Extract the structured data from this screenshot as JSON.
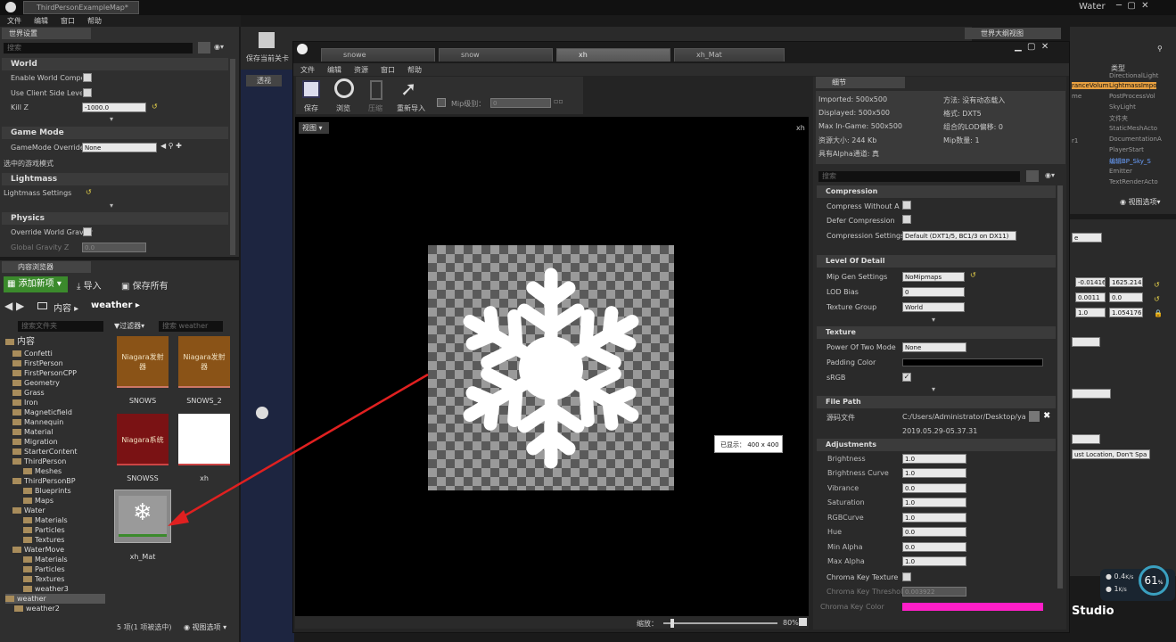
{
  "app": {
    "tab_title": "ThirdPersonExampleMap*",
    "project": "Water",
    "menu": [
      "文件",
      "编辑",
      "窗口",
      "帮助"
    ]
  },
  "world_settings": {
    "title": "世界设置",
    "search_placeholder": "搜索",
    "world": {
      "header": "World",
      "enable_world_composition": "Enable World Compositi",
      "use_client_side_level": "Use Client Side Level S",
      "kill_z_label": "Kill Z",
      "kill_z_value": "-1000.0"
    },
    "game_mode": {
      "header": "Game Mode",
      "override_label": "GameMode Override",
      "override_value": "None",
      "selected_mode": "选中的游戏模式"
    },
    "lightmass": {
      "header": "Lightmass",
      "settings": "Lightmass Settings"
    },
    "physics": {
      "header": "Physics",
      "override_gravity": "Override World Gravity",
      "global_gravity": "Global Gravity Z",
      "global_gravity_value": "0.0"
    }
  },
  "content_browser": {
    "title": "内容浏览器",
    "add_new": "添加新项",
    "import": "导入",
    "save_all": "保存所有",
    "path": [
      "内容",
      "weather"
    ],
    "search_folders": "搜索文件夹",
    "filters": "过滤器",
    "search_assets": "搜索 weather",
    "folders": [
      "内容",
      "Confetti",
      "FirstPerson",
      "FirstPersonCPP",
      "Geometry",
      "Grass",
      "Iron",
      "Magneticfield",
      "Mannequin",
      "Material",
      "Migration",
      "StarterContent",
      "ThirdPerson",
      "Meshes",
      "ThirdPersonBP",
      "Blueprints",
      "Maps",
      "Water",
      "Materials",
      "Particles",
      "Textures",
      "WaterMove",
      "Materials",
      "Particles",
      "Textures",
      "weather3",
      "weather",
      "weather2"
    ],
    "assets": [
      {
        "name": "SNOWS",
        "thumb": "Niagara发射器"
      },
      {
        "name": "SNOWS_2",
        "thumb": "Niagara发射器"
      },
      {
        "name": "SNOWSS",
        "thumb": "Niagara系统"
      },
      {
        "name": "xh",
        "thumb": ""
      },
      {
        "name": "xh_Mat",
        "thumb": ""
      }
    ],
    "status": "5 项(1 项被选中)",
    "view_options": "视图选项"
  },
  "main_toolbar": {
    "save_level": "保存当前关卡"
  },
  "viewport_label": "透视",
  "texture_editor": {
    "tabs": [
      "snowe",
      "snow",
      "xh",
      "xh_Mat"
    ],
    "menu": [
      "文件",
      "编辑",
      "资源",
      "窗口",
      "帮助"
    ],
    "toolbar": {
      "save": "保存",
      "browse": "浏览",
      "compress": "压缩",
      "reimport": "重新导入",
      "mip_label": "Mip级别：",
      "mip_value": "0"
    },
    "view_button": "视图",
    "corner_label": "xh",
    "display_tip": "已显示： 400 x 400",
    "zoom_label": "缩放：",
    "zoom_value": "80%",
    "details_title": "细节",
    "info": {
      "imported": "Imported: 500x500",
      "displayed": "Displayed: 500x500",
      "max_ingame": "Max In-Game: 500x500",
      "resource_size": "资源大小: 244 Kb",
      "has_alpha": "具有Alpha通道: 真",
      "method": "方法: 没有动态载入",
      "format": "格式: DXT5",
      "lod_bias": "组合的LOD偏移: 0",
      "mip_count": "Mip数量: 1"
    },
    "search_placeholder": "搜索",
    "compression": {
      "header": "Compression",
      "without_alpha": "Compress Without Alpha",
      "defer": "Defer Compression",
      "settings_label": "Compression Settings",
      "settings_value": "Default (DXT1/5, BC1/3 on DX11)"
    },
    "lod": {
      "header": "Level Of Detail",
      "mip_gen_label": "Mip Gen Settings",
      "mip_gen_value": "NoMipmaps",
      "lod_bias_label": "LOD Bias",
      "lod_bias_value": "0",
      "group_label": "Texture Group",
      "group_value": "World"
    },
    "texture": {
      "header": "Texture",
      "pot_label": "Power Of Two Mode",
      "pot_value": "None",
      "padding_label": "Padding Color",
      "srgb_label": "sRGB"
    },
    "file_path": {
      "header": "File Path",
      "source_label": "源码文件",
      "source_value": "C:/Users/Administrator/Desktop/yanwu/",
      "timestamp": "2019.05.29-05.37.31"
    },
    "adjustments": {
      "header": "Adjustments",
      "items": [
        {
          "k": "Brightness",
          "v": "1.0"
        },
        {
          "k": "Brightness Curve",
          "v": "1.0"
        },
        {
          "k": "Vibrance",
          "v": "0.0"
        },
        {
          "k": "Saturation",
          "v": "1.0"
        },
        {
          "k": "RGBCurve",
          "v": "1.0"
        },
        {
          "k": "Hue",
          "v": "0.0"
        },
        {
          "k": "Min Alpha",
          "v": "0.0"
        },
        {
          "k": "Max Alpha",
          "v": "1.0"
        }
      ],
      "chroma_key_texture": "Chroma Key Texture",
      "chroma_threshold": "Chroma Key Threshold",
      "chroma_threshold_value": "0.003922",
      "chroma_color": "Chroma Key Color"
    }
  },
  "outliner": {
    "title": "世界大纲视图",
    "type_header": "类型",
    "types": [
      "DirectionalLight",
      "LightmassImpo",
      "PostProcessVol",
      "SkyLight",
      "文件夹",
      "StaticMeshActo",
      "DocumentationA",
      "PlayerStart",
      "编辑BP_Sky_S",
      "Emitter",
      "TextRenderActo"
    ],
    "left_items": [
      "ranceVolum",
      "me",
      "r1"
    ],
    "view_options": "视图选项"
  },
  "right_details": {
    "v1": "-0.01416",
    "v2": "1625.2143",
    "v3": "0.0011",
    "v4": "0.0",
    "v5": "1.0",
    "v6": "1.054176",
    "loc": "ust Location, Don't Spa",
    "tag": "e"
  },
  "stats": {
    "up": "0.4",
    "down": "1",
    "unit": "K/s",
    "percent": "61",
    "percent_unit": "%"
  },
  "studio_label": "Studio",
  "colors": {
    "pink": "#ff1ec8",
    "green": "#3b8a2c",
    "dark_red": "#7a1214",
    "emitter": "#8a5317"
  }
}
